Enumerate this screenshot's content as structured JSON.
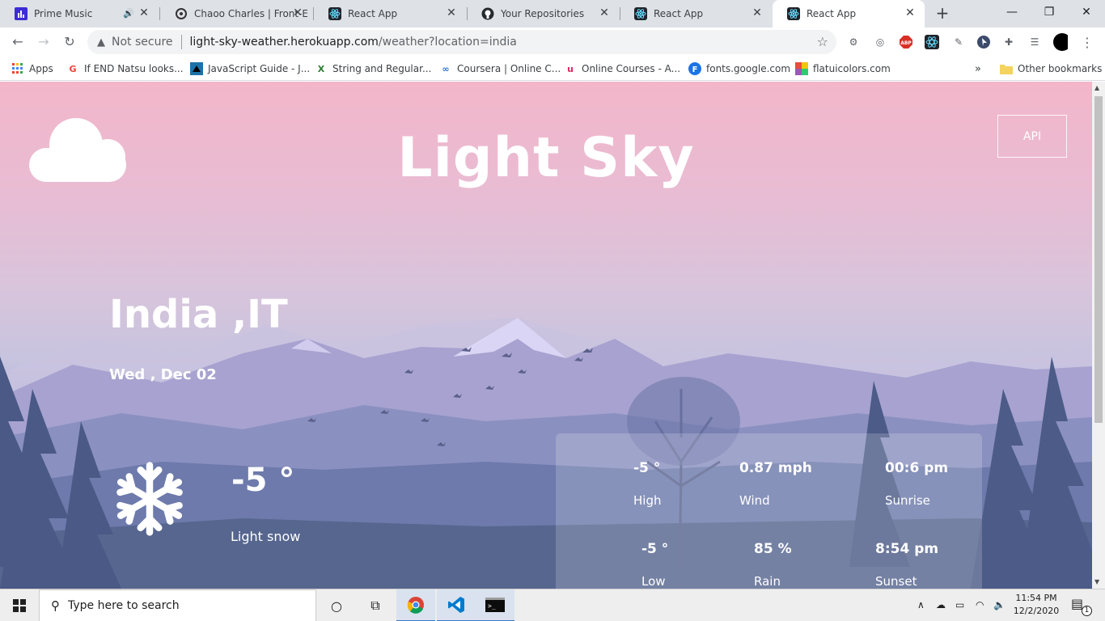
{
  "browser": {
    "tabs": [
      {
        "title": "Prime Music",
        "icon": "prime-music-icon",
        "audio": true
      },
      {
        "title": "Chaoo Charles | Front-E",
        "icon": "chaoo-icon"
      },
      {
        "title": "React App",
        "icon": "react-icon"
      },
      {
        "title": "Your Repositories",
        "icon": "github-icon"
      },
      {
        "title": "React App",
        "icon": "react-icon"
      },
      {
        "title": "React App",
        "icon": "react-icon",
        "active": true
      }
    ],
    "security_label": "Not secure",
    "url_host": "light-sky-weather.herokuapp.com",
    "url_path": "/weather?location=india",
    "bookmarks": [
      {
        "label": "Apps",
        "icon": "apps-grid-icon"
      },
      {
        "label": "If END Natsu looks...",
        "icon": "google-icon"
      },
      {
        "label": "JavaScript Guide - J...",
        "icon": "mdn-icon"
      },
      {
        "label": "String and Regular...",
        "icon": "x-icon"
      },
      {
        "label": "Coursera | Online C...",
        "icon": "coursera-icon"
      },
      {
        "label": "Online Courses - A...",
        "icon": "udemy-icon"
      },
      {
        "label": "fonts.google.com",
        "icon": "fonts-icon"
      },
      {
        "label": "flatuicolors.com",
        "icon": "flatui-icon"
      }
    ],
    "bookmarks_overflow": "»",
    "other_bookmarks": "Other bookmarks"
  },
  "app": {
    "title": "Light Sky",
    "api_button": "API",
    "city": "India ,IT",
    "date": "Wed , Dec 02",
    "temperature": "-5 °",
    "condition": "Light snow",
    "stats": {
      "high_value": "-5 °",
      "high_label": "High",
      "wind_value": "0.87 mph",
      "wind_label": "Wind",
      "sunrise_value": "00:6 pm",
      "sunrise_label": "Sunrise",
      "low_value": "-5 °",
      "low_label": "Low",
      "rain_value": "85 %",
      "rain_label": "Rain",
      "sunset_value": "8:54 pm",
      "sunset_label": "Sunset"
    }
  },
  "taskbar": {
    "search_placeholder": "Type here to search",
    "time": "11:54 PM",
    "date": "12/2/2020",
    "notification_count": "1"
  },
  "colors": {
    "sky_top": "#f3b6c9",
    "sky_mid": "#c7c4df",
    "mountains": "#9d9bc9",
    "forest": "#4d5f8f",
    "accent_blue": "#3a78c9"
  }
}
